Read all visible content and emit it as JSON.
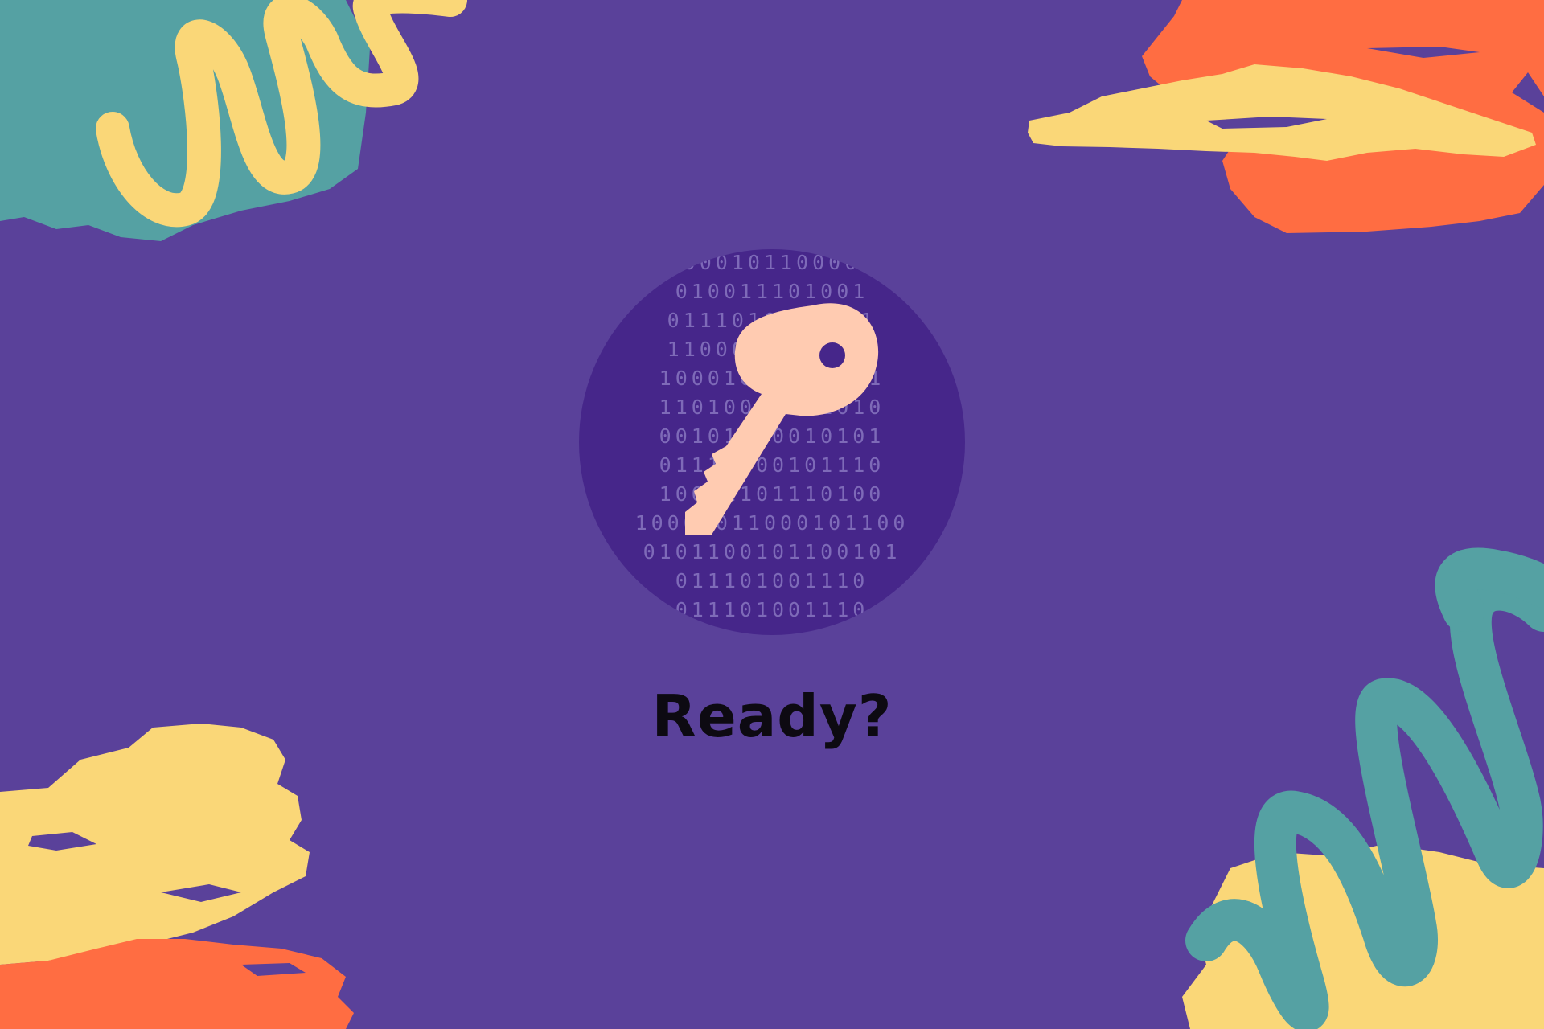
{
  "colors": {
    "background": "#5a419a",
    "teal": "#55a1a3",
    "yellow": "#fad778",
    "orange": "#ff6d42",
    "circle": "#46268a",
    "binary_text": "#7e6ab8",
    "key": "#ffcbb1",
    "caption_text": "#0d0a12"
  },
  "emblem": {
    "icon": "key-icon",
    "binary_rows": [
      "00010110000",
      "010011101001",
      "0111010011001",
      "1100010110110",
      "10001011010001",
      "11010011101010",
      "00101100010101",
      "01110100101110",
      "10011101110100",
      "10001011000101100",
      "0101100101100101",
      "011101001110",
      "011101001110"
    ]
  },
  "caption": "Ready?"
}
